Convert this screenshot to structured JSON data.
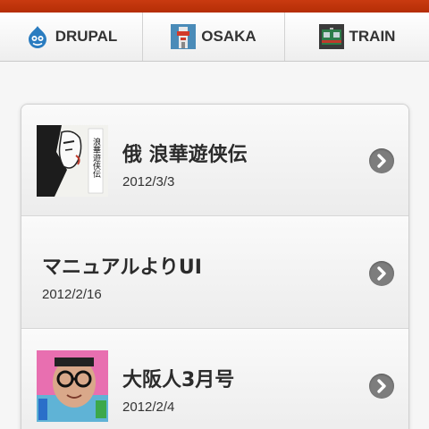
{
  "tabs": [
    {
      "label": "DRUPAL",
      "icon": "drupal-logo-icon"
    },
    {
      "label": "OSAKA",
      "icon": "osaka-tower-icon"
    },
    {
      "label": "TRAIN",
      "icon": "train-icon"
    }
  ],
  "items": [
    {
      "title": "俄 浪華遊侠伝",
      "date": "2012/3/3",
      "thumb": "manga-cover-thumbnail",
      "thumb_text": "浪華遊侠伝"
    },
    {
      "title": "マニュアルよりUI",
      "date": "2012/2/16"
    },
    {
      "title": "大阪人3月号",
      "date": "2012/2/4",
      "thumb": "magazine-cover-thumbnail"
    }
  ],
  "colors": {
    "topbar": "#c23508",
    "drupal_blue": "#2a7cc0",
    "arrow_gray": "#7d7d7d"
  }
}
